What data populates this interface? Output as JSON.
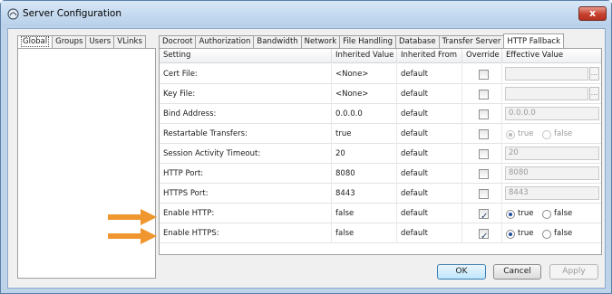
{
  "window": {
    "title": "Server Configuration",
    "close_glyph": "x"
  },
  "left_tabs": [
    {
      "label": "Global",
      "active": true
    },
    {
      "label": "Groups",
      "active": false
    },
    {
      "label": "Users",
      "active": false
    },
    {
      "label": "VLinks",
      "active": false
    }
  ],
  "right_tabs": [
    {
      "label": "Docroot",
      "active": false
    },
    {
      "label": "Authorization",
      "active": false
    },
    {
      "label": "Bandwidth",
      "active": false
    },
    {
      "label": "Network",
      "active": false
    },
    {
      "label": "File Handling",
      "active": false
    },
    {
      "label": "Database",
      "active": false
    },
    {
      "label": "Transfer Server",
      "active": false
    },
    {
      "label": "HTTP Fallback",
      "active": true
    }
  ],
  "table": {
    "headers": [
      "Setting",
      "Inherited Value",
      "Inherited From",
      "Override",
      "Effective Value"
    ],
    "rows": [
      {
        "setting": "Cert File:",
        "inherited_value": "<None>",
        "inherited_from": "default",
        "override": false,
        "effective_type": "file",
        "effective_value": ""
      },
      {
        "setting": "Key File:",
        "inherited_value": "<None>",
        "inherited_from": "default",
        "override": false,
        "effective_type": "file",
        "effective_value": ""
      },
      {
        "setting": "Bind Address:",
        "inherited_value": "0.0.0.0",
        "inherited_from": "default",
        "override": false,
        "effective_type": "text",
        "effective_value": "0.0.0.0"
      },
      {
        "setting": "Restartable Transfers:",
        "inherited_value": "true",
        "inherited_from": "default",
        "override": false,
        "effective_type": "radio",
        "effective_value": "true"
      },
      {
        "setting": "Session Activity Timeout:",
        "inherited_value": "20",
        "inherited_from": "default",
        "override": false,
        "effective_type": "text",
        "effective_value": "20"
      },
      {
        "setting": "HTTP Port:",
        "inherited_value": "8080",
        "inherited_from": "default",
        "override": false,
        "effective_type": "text",
        "effective_value": "8080"
      },
      {
        "setting": "HTTPS Port:",
        "inherited_value": "8443",
        "inherited_from": "default",
        "override": false,
        "effective_type": "text",
        "effective_value": "8443"
      },
      {
        "setting": "Enable HTTP:",
        "inherited_value": "false",
        "inherited_from": "default",
        "override": true,
        "effective_type": "radio",
        "effective_value": "true"
      },
      {
        "setting": "Enable HTTPS:",
        "inherited_value": "false",
        "inherited_from": "default",
        "override": true,
        "effective_type": "radio",
        "effective_value": "true"
      }
    ],
    "radio_true_label": "true",
    "radio_false_label": "false",
    "browse_label": "..."
  },
  "buttons": {
    "ok": "OK",
    "cancel": "Cancel",
    "apply": "Apply"
  },
  "colors": {
    "arrow": "#f0962e",
    "title_bg": "#bcd3ea",
    "ok_border": "#3c7fb1"
  }
}
